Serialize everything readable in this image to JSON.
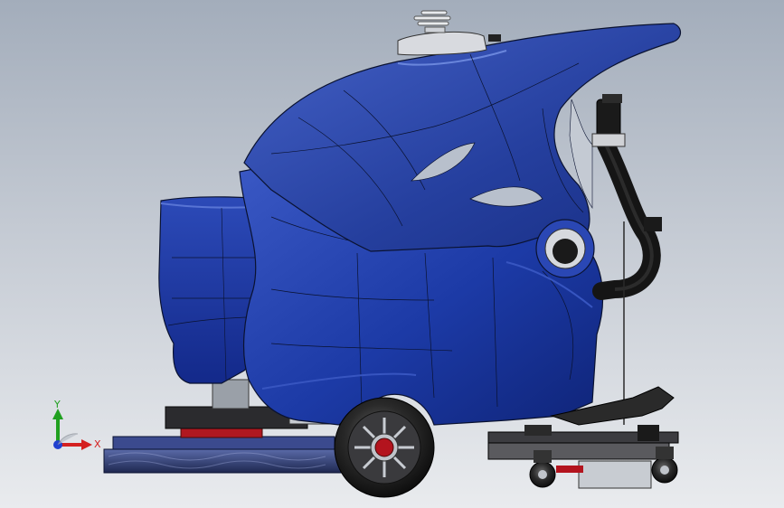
{
  "viewport": {
    "colors": {
      "background_top": "#a3adbb",
      "background_bottom": "#e9ebee",
      "body_blue": "#1c3aa6",
      "body_blue_dark": "#0f2478",
      "body_blue_light": "#3755c0",
      "edge_line": "#0a1230",
      "tire": "#1a1a1a",
      "hub_red": "#b3141e",
      "brush_deck": "#3a4a8a",
      "hose": "#151515"
    }
  },
  "model": {
    "parts": [
      "hood",
      "front-body",
      "recovery-tank",
      "beacon-light",
      "drain-hose",
      "rear-wheel",
      "brush-deck",
      "squeegee-assembly",
      "caster-wheel"
    ]
  },
  "triad": {
    "x_label": "X",
    "y_label": "Y",
    "colors": {
      "x": "#d42020",
      "y": "#20a020",
      "z": "#2040d0"
    }
  }
}
